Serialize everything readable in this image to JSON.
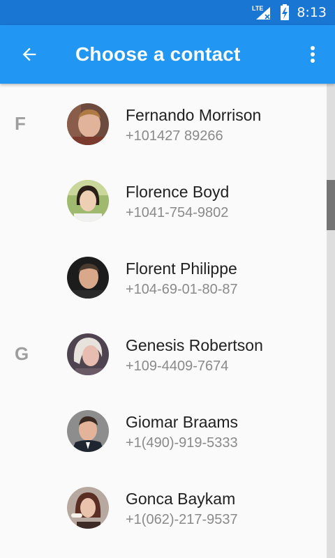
{
  "status_bar": {
    "network": "LTE",
    "time": "8:13",
    "icons": [
      "signal-icon",
      "battery-charging-icon"
    ]
  },
  "app_bar": {
    "title": "Choose a contact",
    "icons": [
      "back-arrow-icon",
      "more-vert-icon"
    ]
  },
  "contacts": [
    {
      "letter": "F",
      "name": "Fernando Morrison",
      "phone": "+101427 89266"
    },
    {
      "letter": "",
      "name": "Florence Boyd",
      "phone": "+1041-754-9802"
    },
    {
      "letter": "",
      "name": "Florent Philippe",
      "phone": "+104-69-01-80-87"
    },
    {
      "letter": "G",
      "name": "Genesis Robertson",
      "phone": "+109-4409-7674"
    },
    {
      "letter": "",
      "name": "Giomar Braams",
      "phone": "+1(490)-919-5333"
    },
    {
      "letter": "",
      "name": "Gonca Baykam",
      "phone": "+1(062)-217-9537"
    }
  ],
  "colors": {
    "status_bar": "#1976d2",
    "app_bar": "#2196f3",
    "section_letter": "#9e9e9e",
    "name_text": "#212121",
    "phone_text": "#8a8a8a"
  }
}
